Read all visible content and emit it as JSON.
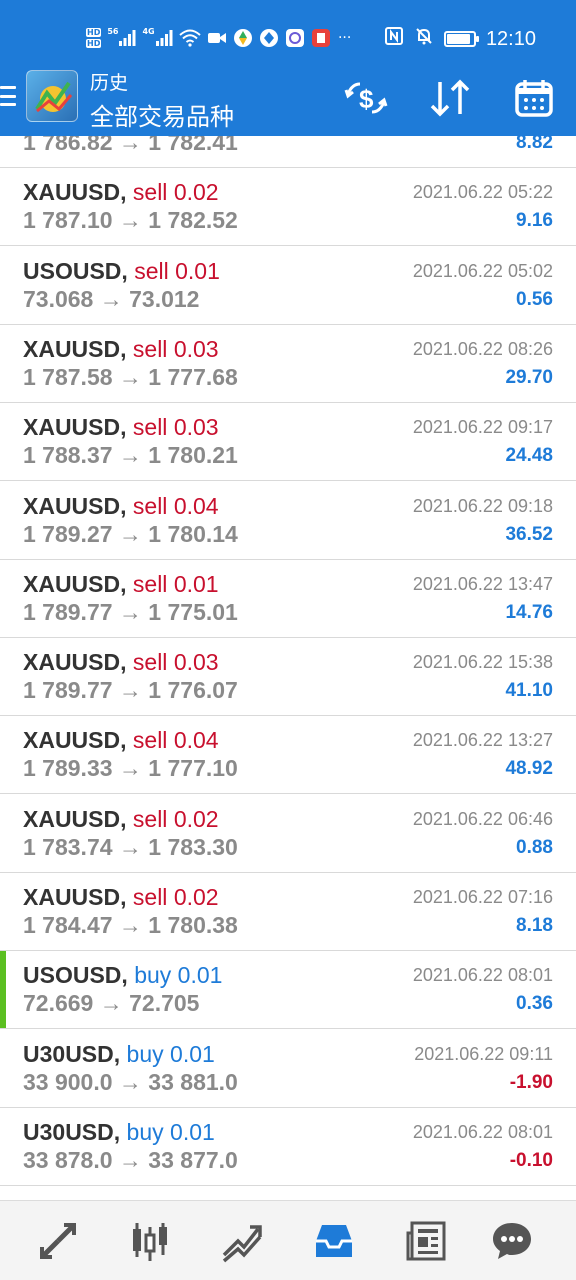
{
  "statusbar": {
    "hd1": "HD",
    "hd2": "HD",
    "net1": "56",
    "net2": "4G",
    "more": "···",
    "time": "12:10",
    "battery_level": 0.9
  },
  "toolbar": {
    "title": "历史",
    "subtitle": "全部交易品种"
  },
  "deals": [
    {
      "symbol": "",
      "side": "",
      "lots": "",
      "prices": "1 786.82 → 1 782.41",
      "time": "",
      "profit": "8.82",
      "sign": "pos"
    },
    {
      "symbol": "XAUUSD,",
      "side": "sell",
      "lots": "0.02",
      "prices": "1 787.10 → 1 782.52",
      "time": "2021.06.22 05:22",
      "profit": "9.16",
      "sign": "pos"
    },
    {
      "symbol": "USOUSD,",
      "side": "sell",
      "lots": "0.01",
      "prices": "73.068 → 73.012",
      "time": "2021.06.22 05:02",
      "profit": "0.56",
      "sign": "pos"
    },
    {
      "symbol": "XAUUSD,",
      "side": "sell",
      "lots": "0.03",
      "prices": "1 787.58 → 1 777.68",
      "time": "2021.06.22 08:26",
      "profit": "29.70",
      "sign": "pos"
    },
    {
      "symbol": "XAUUSD,",
      "side": "sell",
      "lots": "0.03",
      "prices": "1 788.37 → 1 780.21",
      "time": "2021.06.22 09:17",
      "profit": "24.48",
      "sign": "pos"
    },
    {
      "symbol": "XAUUSD,",
      "side": "sell",
      "lots": "0.04",
      "prices": "1 789.27 → 1 780.14",
      "time": "2021.06.22 09:18",
      "profit": "36.52",
      "sign": "pos"
    },
    {
      "symbol": "XAUUSD,",
      "side": "sell",
      "lots": "0.01",
      "prices": "1 789.77 → 1 775.01",
      "time": "2021.06.22 13:47",
      "profit": "14.76",
      "sign": "pos"
    },
    {
      "symbol": "XAUUSD,",
      "side": "sell",
      "lots": "0.03",
      "prices": "1 789.77 → 1 776.07",
      "time": "2021.06.22 15:38",
      "profit": "41.10",
      "sign": "pos"
    },
    {
      "symbol": "XAUUSD,",
      "side": "sell",
      "lots": "0.04",
      "prices": "1 789.33 → 1 777.10",
      "time": "2021.06.22 13:27",
      "profit": "48.92",
      "sign": "pos"
    },
    {
      "symbol": "XAUUSD,",
      "side": "sell",
      "lots": "0.02",
      "prices": "1 783.74 → 1 783.30",
      "time": "2021.06.22 06:46",
      "profit": "0.88",
      "sign": "pos"
    },
    {
      "symbol": "XAUUSD,",
      "side": "sell",
      "lots": "0.02",
      "prices": "1 784.47 → 1 780.38",
      "time": "2021.06.22 07:16",
      "profit": "8.18",
      "sign": "pos"
    },
    {
      "symbol": "USOUSD,",
      "side": "buy",
      "lots": "0.01",
      "prices": "72.669 → 72.705",
      "time": "2021.06.22 08:01",
      "profit": "0.36",
      "sign": "pos",
      "highlight": true
    },
    {
      "symbol": "U30USD,",
      "side": "buy",
      "lots": "0.01",
      "prices": "33 900.0 → 33 881.0",
      "time": "2021.06.22 09:11",
      "profit": "-1.90",
      "sign": "neg"
    },
    {
      "symbol": "U30USD,",
      "side": "buy",
      "lots": "0.01",
      "prices": "33 878.0 → 33 877.0",
      "time": "2021.06.22 08:01",
      "profit": "-0.10",
      "sign": "neg"
    }
  ],
  "bottom_nav": [
    {
      "name": "quotes-icon",
      "active": false
    },
    {
      "name": "chart-icon",
      "active": false
    },
    {
      "name": "trade-icon",
      "active": false
    },
    {
      "name": "history-icon",
      "active": true
    },
    {
      "name": "news-icon",
      "active": false
    },
    {
      "name": "chat-icon",
      "active": false
    }
  ],
  "colors": {
    "accent": "#1e7bd8",
    "sell": "#c8102e",
    "buy": "#1e7bd8",
    "profit_positive": "#1e7bd8",
    "profit_negative": "#c8102e",
    "highlight_bar": "#5bbf21",
    "nav_inactive": "#555555"
  }
}
